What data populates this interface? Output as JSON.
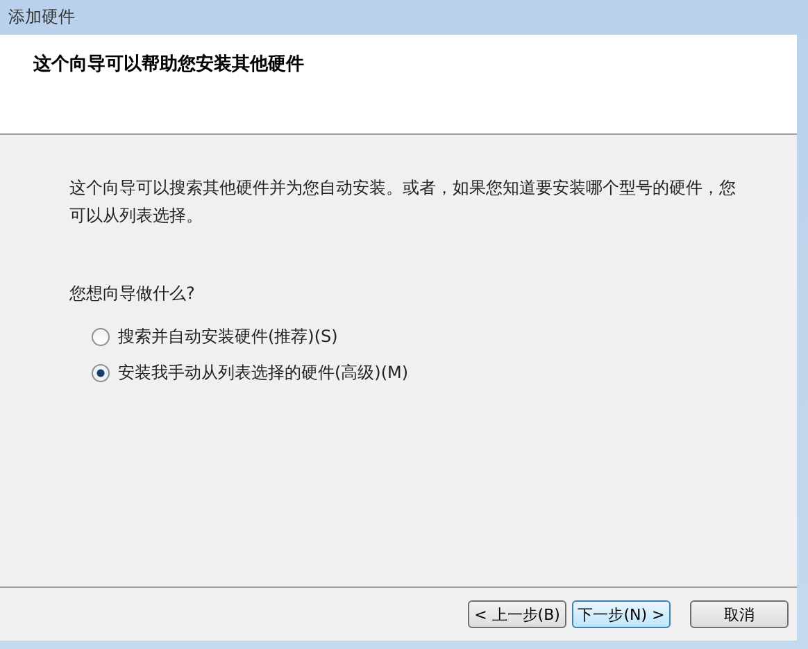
{
  "window": {
    "title": "添加硬件"
  },
  "header": {
    "title": "这个向导可以帮助您安装其他硬件"
  },
  "description": "这个向导可以搜索其他硬件并为您自动安装。或者，如果您知道要安装哪个型号的硬件，您可以从列表选择。",
  "question": "您想向导做什么?",
  "options": [
    {
      "label": "搜索并自动安装硬件(推荐)(S)",
      "selected": false
    },
    {
      "label": "安装我手动从列表选择的硬件(高级)(M)",
      "selected": true
    }
  ],
  "buttons": [
    {
      "label": "< 上一步(B)",
      "focused": false
    },
    {
      "label": "下一步(N) >",
      "focused": true
    },
    {
      "label": "取消",
      "focused": false
    }
  ]
}
